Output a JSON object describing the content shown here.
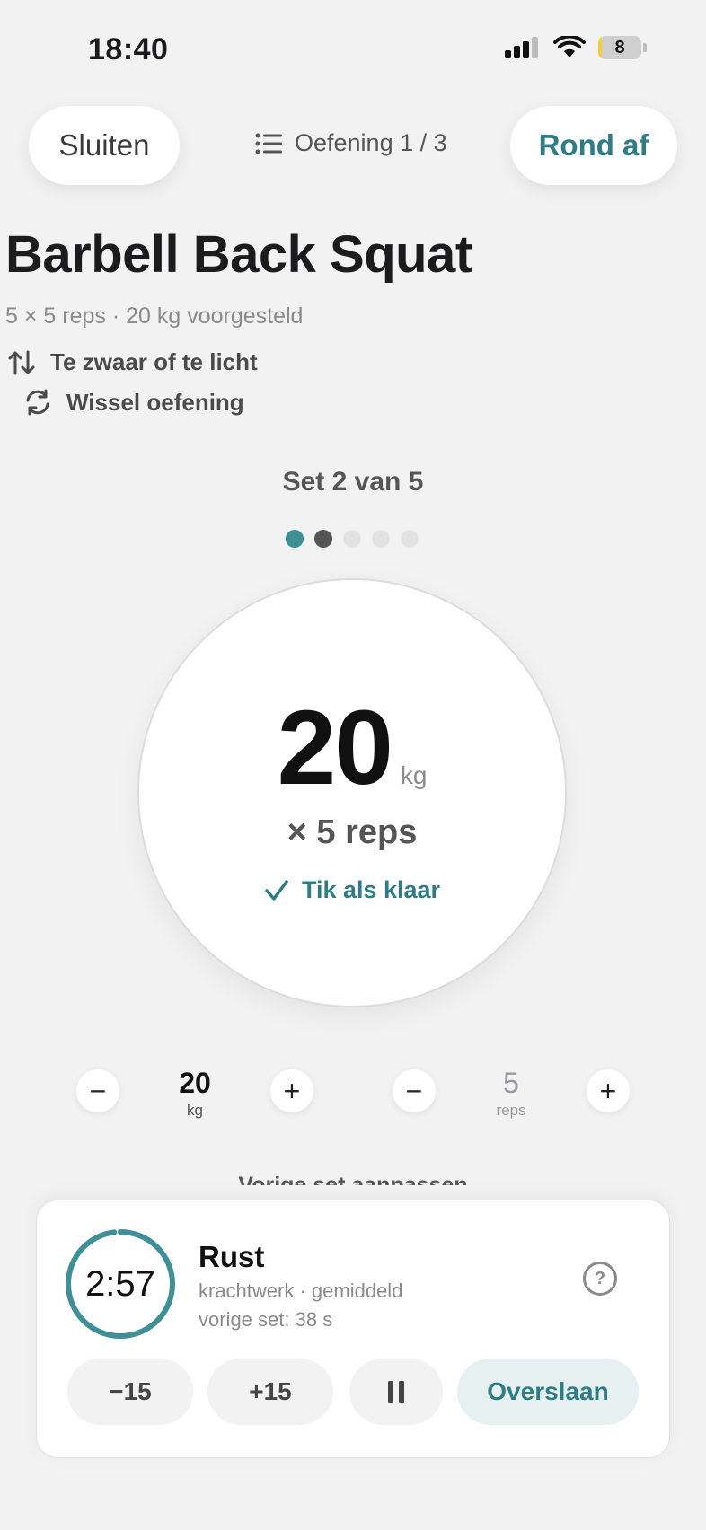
{
  "status_bar": {
    "time": "18:40",
    "battery": "8",
    "battery_level": 0.08
  },
  "header": {
    "close_label": "Sluiten",
    "exercise_counter": "Oefening 1 / 3",
    "finish_label": "Rond af"
  },
  "exercise": {
    "title": "Barbell Back Squat",
    "subtitle": "5 × 5 reps · 20 kg voorgesteld",
    "too_heavy_label": "Te zwaar of te licht",
    "swap_label": "Wissel oefening"
  },
  "set": {
    "label": "Set 2 van 5",
    "current": 2,
    "total": 5,
    "dots": [
      "done",
      "current",
      "pending",
      "pending",
      "pending"
    ]
  },
  "colors": {
    "accent": "#2f7c84",
    "dot_done": "#3f8f96",
    "dot_current": "#555555",
    "dot_pending": "#e3e3e3"
  },
  "target": {
    "weight": "20",
    "weight_unit": "kg",
    "reps_line": "× 5 reps",
    "tap_done_label": "Tik als klaar"
  },
  "steppers": {
    "weight": {
      "minus": "−",
      "value": "20",
      "unit": "kg",
      "plus": "+"
    },
    "reps": {
      "minus": "−",
      "value": "5",
      "unit": "reps",
      "plus": "+"
    }
  },
  "prev_adjust_label": "Vorige set aanpassen",
  "rest": {
    "time": "2:57",
    "progress": 0.98,
    "title": "Rust",
    "subtitle": "krachtwerk · gemiddeld",
    "previous": "vorige set: 38 s",
    "help": "?",
    "minus15": "−15",
    "plus15": "+15",
    "skip_label": "Overslaan"
  }
}
